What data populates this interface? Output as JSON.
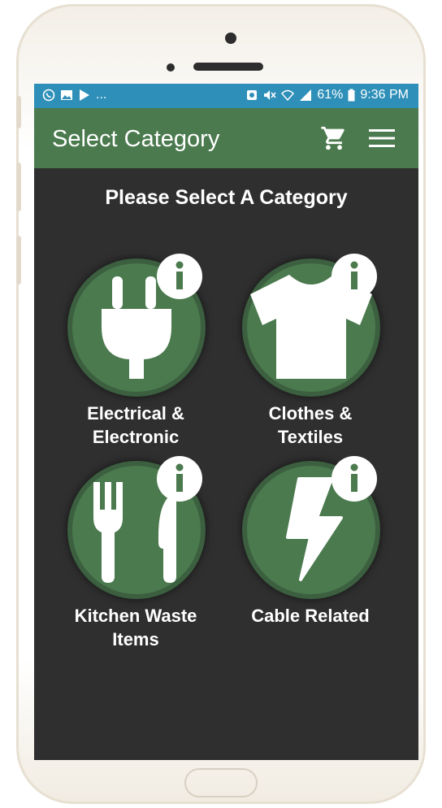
{
  "status_bar": {
    "left_notifications": "...",
    "battery": "61%",
    "time": "9:36 PM"
  },
  "app_bar": {
    "title": "Select Category"
  },
  "main": {
    "heading": "Please Select A Category",
    "categories": [
      {
        "line1": "Electrical &",
        "line2": "Electronic",
        "icon": "plug-icon"
      },
      {
        "line1": "Clothes &",
        "line2": "Textiles",
        "icon": "shirt-icon"
      },
      {
        "line1": "Kitchen Waste",
        "line2": "Items",
        "icon": "cutlery-icon"
      },
      {
        "line1": "Cable Related",
        "line2": "",
        "icon": "lightning-icon"
      }
    ]
  },
  "colors": {
    "status_bar": "#2e8fb8",
    "app_bar": "#4b7a4e",
    "screen_bg": "#2f2f2f",
    "category_circle": "#4b7a4e",
    "info_badge": "#ffffff"
  }
}
